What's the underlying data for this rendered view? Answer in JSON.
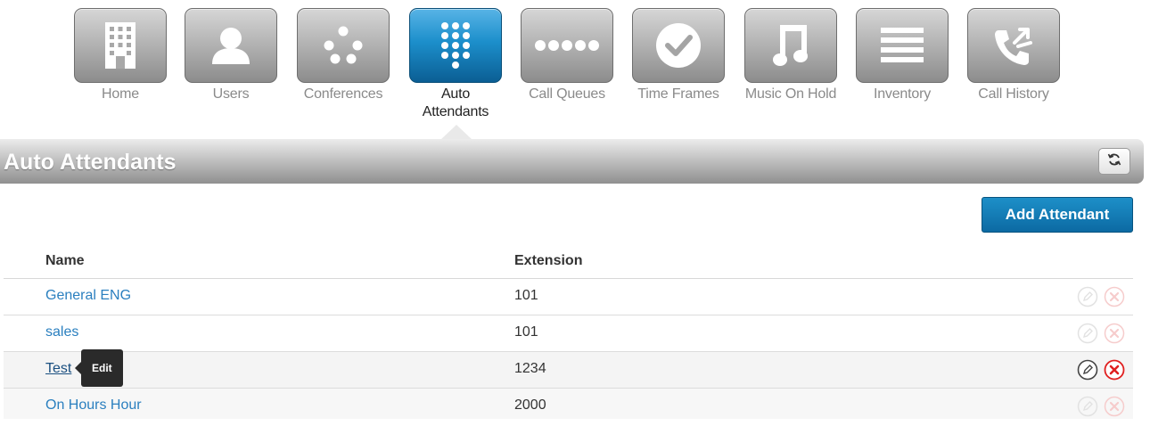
{
  "nav": {
    "items": [
      {
        "label": "Home",
        "icon": "building-icon"
      },
      {
        "label": "Users",
        "icon": "user-icon"
      },
      {
        "label": "Conferences",
        "icon": "conference-dots-icon"
      },
      {
        "label": "Auto Attendants",
        "icon": "keypad-icon",
        "active": true
      },
      {
        "label": "Call Queues",
        "icon": "queue-dots-icon"
      },
      {
        "label": "Time Frames",
        "icon": "clock-icon"
      },
      {
        "label": "Music On Hold",
        "icon": "music-note-icon"
      },
      {
        "label": "Inventory",
        "icon": "list-lines-icon"
      },
      {
        "label": "Call History",
        "icon": "phone-history-icon"
      }
    ]
  },
  "header": {
    "title": "Auto Attendants",
    "refresh_icon": "refresh-icon"
  },
  "toolbar": {
    "add_label": "Add Attendant"
  },
  "table": {
    "columns": [
      "Name",
      "Extension"
    ],
    "rows": [
      {
        "name": "General ENG",
        "extension": "101"
      },
      {
        "name": "sales",
        "extension": "101"
      },
      {
        "name": "Test",
        "extension": "1234"
      },
      {
        "name": "On Hours Hour",
        "extension": "2000"
      }
    ]
  },
  "tooltip": {
    "text": "Edit"
  },
  "colors": {
    "accent": "#1a84c0",
    "link": "#2a7fbf",
    "delete": "#e02020"
  }
}
